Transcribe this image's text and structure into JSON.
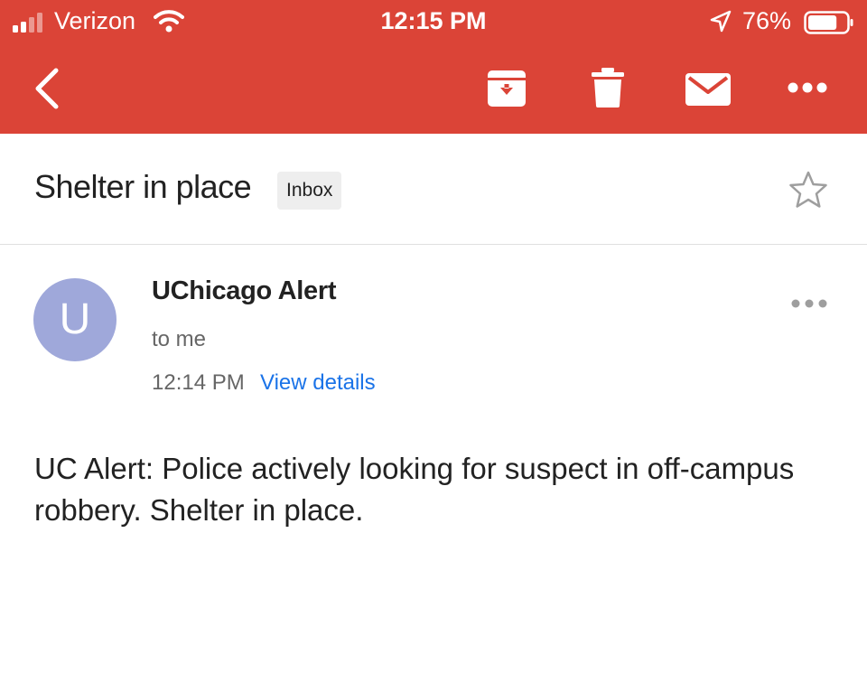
{
  "status_bar": {
    "carrier": "Verizon",
    "time": "12:15 PM",
    "battery": "76%",
    "battery_level": 0.76
  },
  "toolbar": {
    "icons": [
      "back-icon",
      "archive-icon",
      "trash-icon",
      "mark-unread-icon",
      "more-icon"
    ],
    "background": "#db4437"
  },
  "email": {
    "subject": "Shelter in place",
    "label": "Inbox",
    "sender": "UChicago Alert",
    "avatar_letter": "U",
    "avatar_color": "#9fa8da",
    "recipient": "to me",
    "time": "12:14 PM",
    "details_link": "View details",
    "body": "UC Alert: Police actively looking for suspect in off-campus robbery. Shelter in place."
  }
}
